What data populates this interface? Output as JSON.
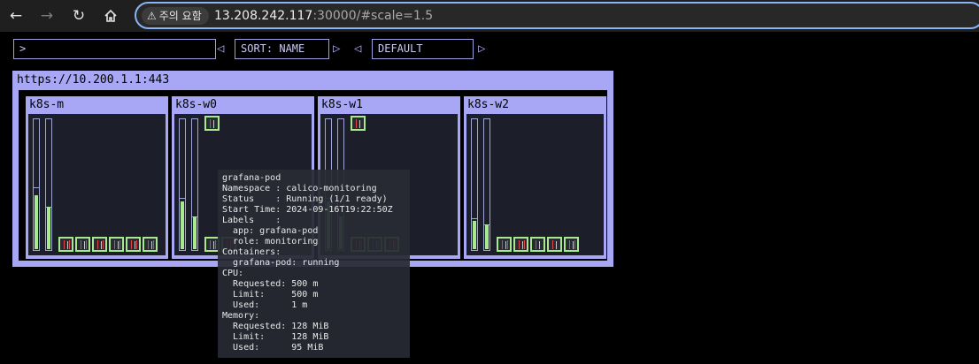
{
  "browser": {
    "back_icon": "arrow-left-icon",
    "forward_icon": "arrow-right-icon",
    "reload_icon": "reload-icon",
    "home_icon": "home-icon",
    "security_warning": "주의 요함",
    "url_host": "13.208.242.117",
    "url_rest": ":30000/#scale=1.5"
  },
  "toolbar": {
    "filter_value": ">",
    "sort_label": "SORT: NAME",
    "theme_label": "DEFAULT"
  },
  "cluster": {
    "url": "https://10.200.1.1:443",
    "colors": {
      "frame": "#a7a7f5",
      "pod_ok": "#a8e98d",
      "node_bg": "#1c1e2a"
    },
    "nodes": [
      {
        "name": "k8s-m",
        "cpu": {
          "requested": 0.48,
          "used": 0.42
        },
        "memory": {
          "requested": 0.33,
          "used": 0.33
        },
        "pod_count": 6
      },
      {
        "name": "k8s-w0",
        "cpu": {
          "requested": 0.4,
          "used": 0.37
        },
        "memory": {
          "requested": 0.25,
          "used": 0.25
        },
        "pod_count": 3
      },
      {
        "name": "k8s-w1",
        "cpu": {
          "requested": 0.4,
          "used": 0.37
        },
        "memory": {
          "requested": 0.25,
          "used": 0.25
        },
        "pod_count": 4
      },
      {
        "name": "k8s-w2",
        "cpu": {
          "requested": 0.24,
          "used": 0.22
        },
        "memory": {
          "requested": 0.19,
          "used": 0.19
        },
        "pod_count": 5
      }
    ]
  },
  "tooltip": {
    "lines": [
      "grafana-pod",
      "Namespace : calico-monitoring",
      "Status    : Running (1/1 ready)",
      "Start Time: 2024-09-16T19:22:50Z",
      "Labels    :",
      "  app: grafana-pod",
      "  role: monitoring",
      "Containers:",
      "  grafana-pod: running",
      "CPU:",
      "  Requested: 500 m",
      "  Limit:     500 m",
      "  Used:      1 m",
      "Memory:",
      "  Requested: 128 MiB",
      "  Limit:     128 MiB",
      "  Used:      95 MiB"
    ]
  }
}
